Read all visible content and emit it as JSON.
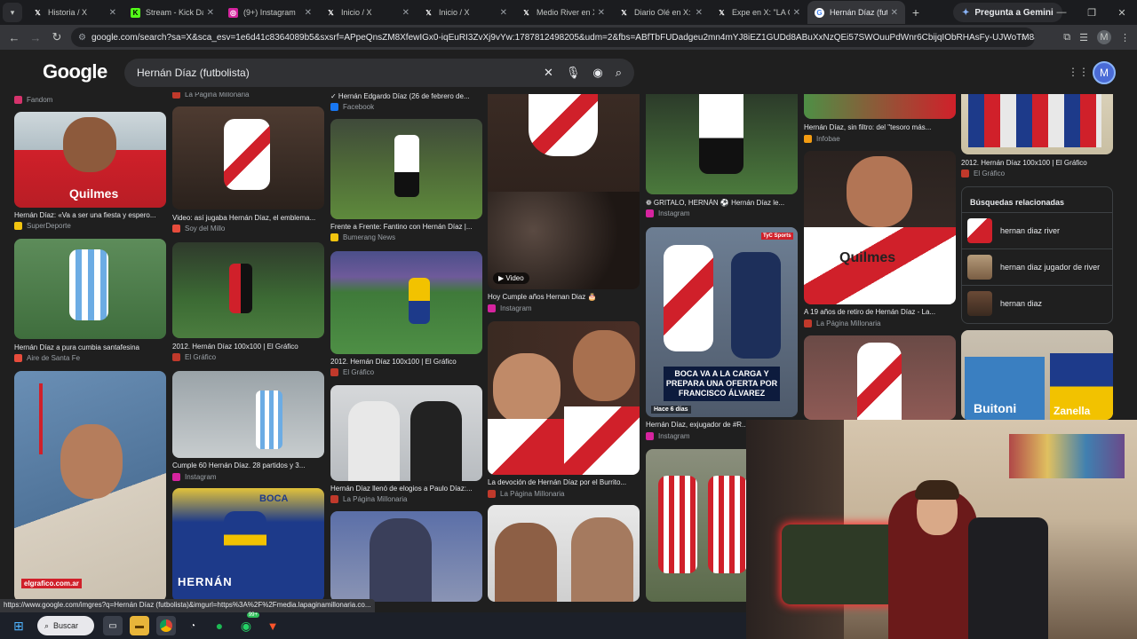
{
  "browser": {
    "tabs": [
      {
        "title": "Historia / X",
        "icon": "x-icon"
      },
      {
        "title": "Stream - Kick Da",
        "icon": "kick-icon"
      },
      {
        "title": "(9+) Instagram",
        "icon": "instagram-icon"
      },
      {
        "title": "Inicio / X",
        "icon": "x-icon"
      },
      {
        "title": "Inicio / X",
        "icon": "x-icon"
      },
      {
        "title": "Medio River en X",
        "icon": "x-icon"
      },
      {
        "title": "Diario Olé en X: \"",
        "icon": "x-icon"
      },
      {
        "title": "Expe en X: \"LA Cl",
        "icon": "x-icon"
      },
      {
        "title": "Hernán Díaz (futb",
        "icon": "google-icon",
        "active": true
      }
    ],
    "new_tab": "+",
    "gemini_label": "Pregunta a Gemini",
    "url": "google.com/search?sa=X&sca_esv=1e6d41c8364089b5&sxsrf=APpeQnsZM8XfewIGx0-iqEuRI3ZvXj9vYw:1787812498205&udm=2&fbs=ABfTbFUDadgeu2mn4mYJ8iEZ1GUDd8ABuXxNzQEi57SWOuuPdWnr6CbijqIObRHAsFy-UJWoTM8aZiBG_34I3eK4...",
    "profile_letter": "M"
  },
  "google": {
    "logo": "Google",
    "query": "Hernán Díaz (futbolista)",
    "account_letter": "M"
  },
  "top_sources": [
    {
      "source": "Fandom",
      "color": "#d6336c"
    },
    {
      "source": "La Página Millonaria",
      "color": "#c0392b"
    },
    {
      "caption": "✓ Hernán Edgardo Díaz (26 de febrero de...",
      "source": "Facebook",
      "color": "#1877f2"
    },
    {
      "caption": "Hernán Díaz, sin filtro: del \"tesoro más...",
      "source": "Infobae",
      "color": "#f39c12"
    },
    {
      "caption": "2012. Hernán Díaz 100x100 | El Gráfico",
      "source": "El Gráfico",
      "color": "#c0392b"
    },
    {
      "caption": "❁ GRITALO, HERNÁN ⚽ Hernán Díaz le...",
      "source": "Instagram",
      "color": "#d6249f"
    }
  ],
  "results": [
    {
      "caption": "Hernán Díaz: «Va a ser una fiesta y espero...",
      "source": "SuperDeporte",
      "color": "#f1c40f"
    },
    {
      "caption": "Video: así jugaba Hernán Díaz, el emblema...",
      "source": "Soy del Millo",
      "color": "#e74c3c"
    },
    {
      "caption": "Frente a Frente: Fantino con Hernán Díaz |...",
      "source": "Bumerang News",
      "color": "#f1c40f"
    },
    {
      "caption": "Hoy Cumple años Hernan Diaz 🎂",
      "source": "Instagram",
      "color": "#d6249f",
      "badge": "▶ Video"
    },
    {
      "caption": "A 19 años de retiro de Hernán Díaz - La...",
      "source": "La Página Millonaria",
      "color": "#c0392b"
    },
    {
      "caption": "Hernán Díaz a pura cumbia santafesina",
      "source": "Aire de Santa Fe",
      "color": "#e74c3c"
    },
    {
      "caption": "2012. Hernán Díaz 100x100 | El Gráfico",
      "source": "El Gráfico",
      "color": "#c0392b"
    },
    {
      "caption": "2012. Hernán Díaz 100x100 | El Gráfico",
      "source": "El Gráfico",
      "color": "#c0392b"
    },
    {
      "caption": "Hernán Díaz, exjugador de #R...",
      "source": "Instagram",
      "color": "#d6249f"
    },
    {
      "caption": "La devoción de Hernán Díaz por el Burrito...",
      "source": "La Página Millonaria",
      "color": "#c0392b"
    },
    {
      "caption": "Cumple 60 Hernán Díaz. 28 partidos y 3...",
      "source": "Instagram",
      "color": "#d6249f"
    },
    {
      "caption": "Hernán Díaz llenó de elogios a Paulo Díaz:...",
      "source": "La Página Millonaria",
      "color": "#c0392b"
    }
  ],
  "image_text": {
    "graphic_stamp": "elgrafico.com.ar",
    "tyc": "TyC Sports",
    "boca_overlay": "BOCA VA A LA CARGA Y PREPARA UNA OFERTA POR FRANCISCO ÁLVAREZ",
    "age": "Hace 6 días",
    "hernan": "HERNÁN",
    "buitoni": "Buitoni",
    "zanella": "Zanella",
    "quilmes": "Quilmes",
    "boca_banner": "BOCA"
  },
  "related": {
    "heading": "Búsquedas relacionadas",
    "items": [
      "hernan diaz river",
      "hernan diaz jugador de river",
      "hernan diaz"
    ]
  },
  "status_url": "https://www.google.com/imgres?q=Hernán Díaz (futbolista)&imgurl=https%3A%2F%2Fmedia.lapaginamillonaria.co...",
  "taskbar": {
    "search_label": "Buscar",
    "whatsapp_badge": "99+"
  },
  "colors": {
    "river_red": "#d0202a",
    "page_bg": "#1f1f1f",
    "link_blue": "#8ab4f8"
  }
}
